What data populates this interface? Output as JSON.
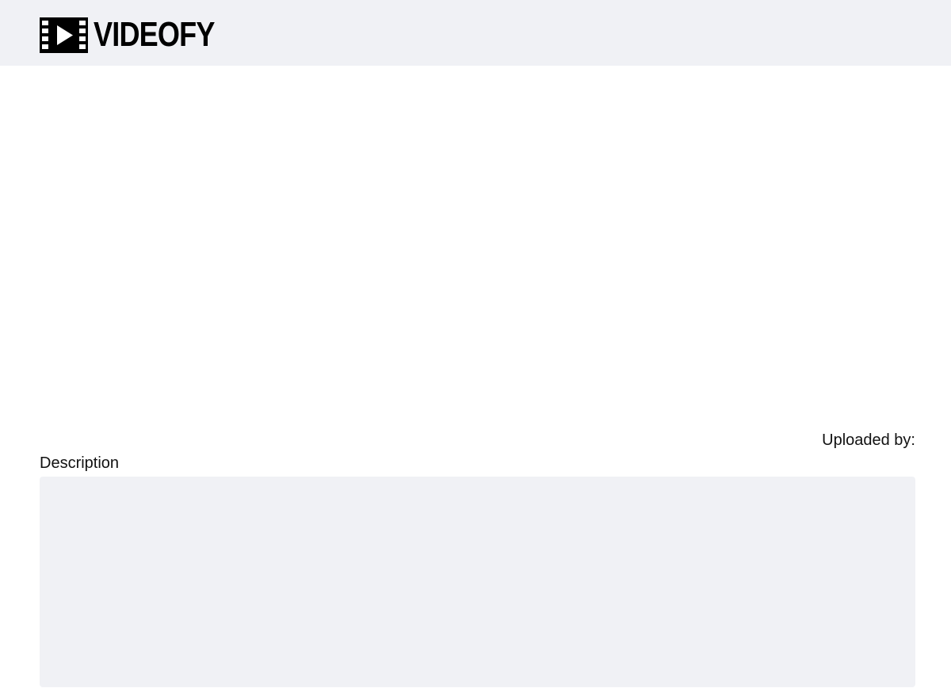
{
  "header": {
    "brand": "VIDEOFY",
    "logo_icon": "film-play-icon",
    "background": "#f0f1f5"
  },
  "video": {
    "player_icon": "video-player"
  },
  "meta": {
    "uploaded_by_label": "Uploaded by:"
  },
  "description": {
    "label": "Description",
    "text": ""
  }
}
